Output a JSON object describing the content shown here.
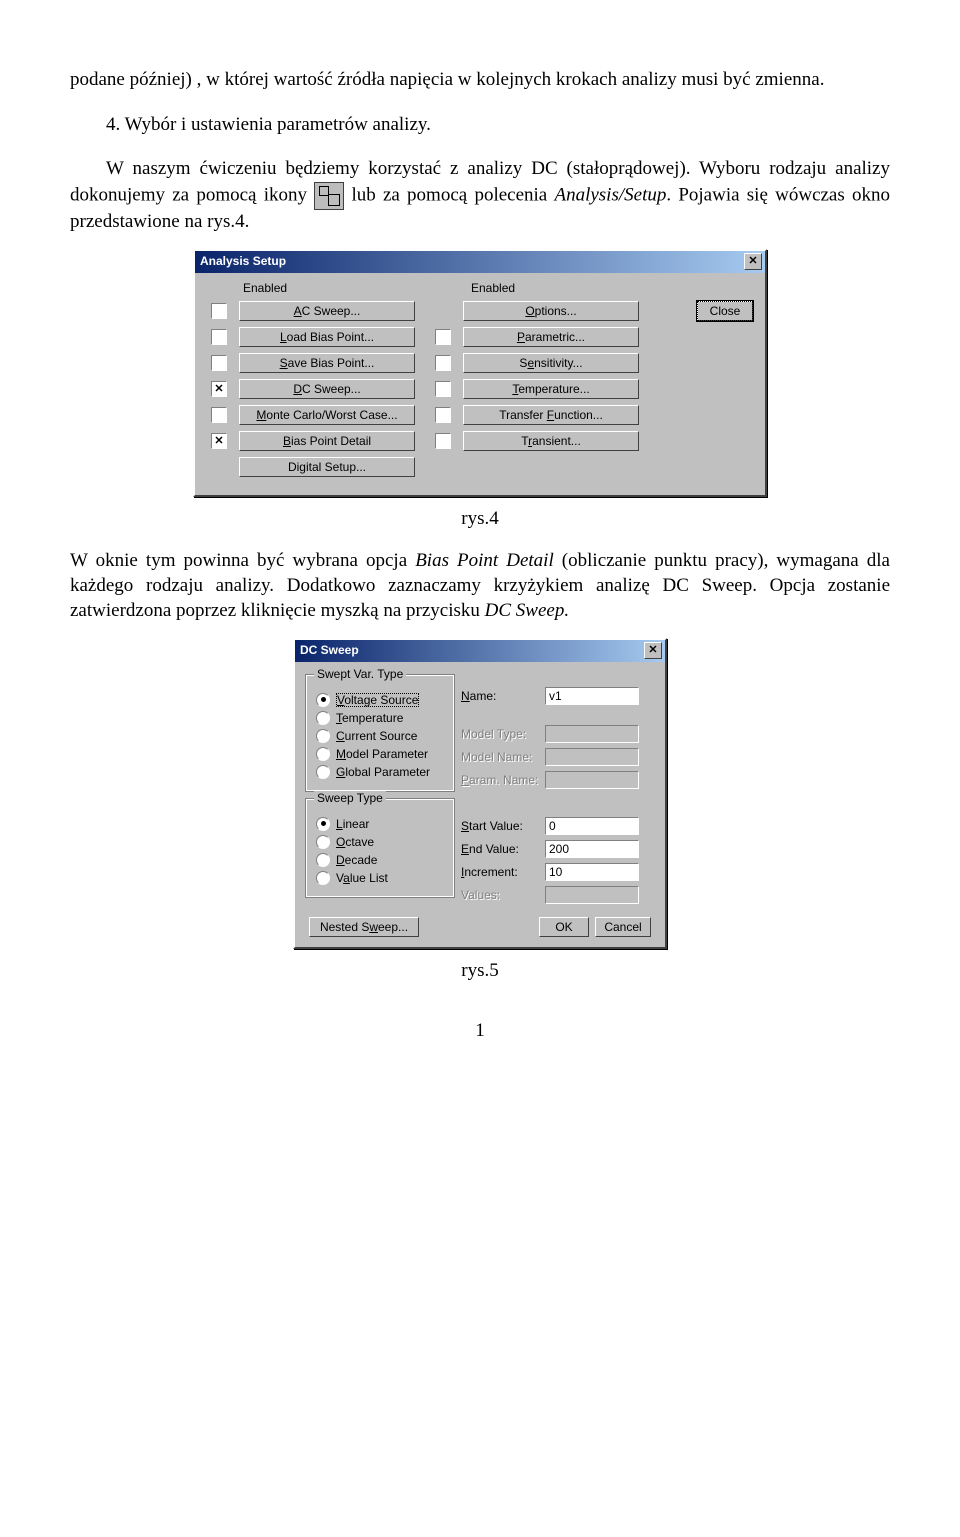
{
  "text": {
    "p1": "podane później) , w której wartość źródła napięcia w kolejnych krokach analizy musi być zmienna.",
    "p2": "4. Wybór i ustawienia parametrów analizy.",
    "p3a": "W naszym ćwiczeniu będziemy korzystać z analizy DC (stałoprądowej). Wyboru  rodzaju analizy dokonujemy za pomocą ikony",
    "p3b": " lub za pomocą polecenia ",
    "p3c": "Analysis/Setup",
    "p3d": ". Pojawia się wówczas okno przedstawione na rys.4.",
    "cap4": "rys.4",
    "p4a": "W oknie tym powinna być wybrana opcja ",
    "p4b": "Bias Point Detail",
    "p4c": " (obliczanie punktu pracy), wymagana dla każdego rodzaju analizy. Dodatkowo zaznaczamy krzyżykiem analizę DC Sweep. Opcja zostanie zatwierdzona poprzez kliknięcie myszką na przycisku ",
    "p4d": "DC Sweep.",
    "cap5": "rys.5",
    "page": "1"
  },
  "analysis_setup": {
    "title": "Analysis Setup",
    "enabled": "Enabled",
    "close": "Close",
    "left": [
      {
        "chk": false,
        "label": "AC Sweep...",
        "u": "A"
      },
      {
        "chk": false,
        "label": "Load Bias Point...",
        "u": "L"
      },
      {
        "chk": false,
        "label": "Save Bias Point...",
        "u": "S"
      },
      {
        "chk": true,
        "label": "DC Sweep...",
        "u": "D"
      },
      {
        "chk": false,
        "label": "Monte Carlo/Worst Case...",
        "u": "M"
      },
      {
        "chk": true,
        "label": "Bias Point Detail",
        "u": "B"
      },
      {
        "chk": null,
        "label": "Digital Setup...",
        "u": "g"
      }
    ],
    "right": [
      {
        "chk": null,
        "label": "Options...",
        "u": "O"
      },
      {
        "chk": false,
        "label": "Parametric...",
        "u": "P"
      },
      {
        "chk": false,
        "label": "Sensitivity...",
        "u": "e"
      },
      {
        "chk": false,
        "label": "Temperature...",
        "u": "T"
      },
      {
        "chk": false,
        "label": "Transfer Function...",
        "u": "F"
      },
      {
        "chk": false,
        "label": "Transient...",
        "u": "r"
      }
    ]
  },
  "dc_sweep": {
    "title": "DC Sweep",
    "group1": {
      "legend": "Swept Var. Type",
      "options": [
        {
          "sel": true,
          "label": "Voltage Source",
          "u": "V"
        },
        {
          "sel": false,
          "label": "Temperature",
          "u": "T"
        },
        {
          "sel": false,
          "label": "Current Source",
          "u": "C"
        },
        {
          "sel": false,
          "label": "Model Parameter",
          "u": "M"
        },
        {
          "sel": false,
          "label": "Global Parameter",
          "u": "G"
        }
      ]
    },
    "group2": {
      "legend": "Sweep Type",
      "options": [
        {
          "sel": true,
          "label": "Linear",
          "u": "L"
        },
        {
          "sel": false,
          "label": "Octave",
          "u": "O"
        },
        {
          "sel": false,
          "label": "Decade",
          "u": "D"
        },
        {
          "sel": false,
          "label": "Value List",
          "u": "a"
        }
      ]
    },
    "fields": {
      "name_lbl": "Name:",
      "name_u": "N",
      "name_val": "v1",
      "model_type": "Model Type:",
      "model_name": "Model Name:",
      "param_name": "Param. Name:",
      "param_u": "P",
      "start_lbl": "Start Value:",
      "start_u": "S",
      "start_val": "0",
      "end_lbl": "End Value:",
      "end_u": "E",
      "end_val": "200",
      "inc_lbl": "Increment:",
      "inc_u": "I",
      "inc_val": "10",
      "values_lbl": "Values:"
    },
    "nested": "Nested Sweep...",
    "nested_u": "w",
    "ok": "OK",
    "cancel": "Cancel"
  }
}
